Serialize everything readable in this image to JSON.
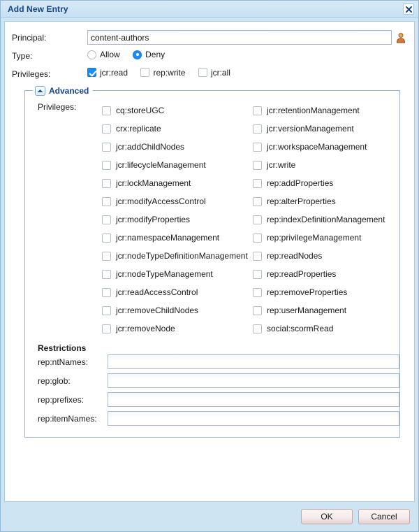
{
  "window": {
    "title": "Add New Entry",
    "close_icon": "close-icon",
    "close_label": "X"
  },
  "form": {
    "principal": {
      "label": "Principal:",
      "value": "content-authors",
      "placeholder": "",
      "picker_icon": "user-picker-icon"
    },
    "type": {
      "label": "Type:",
      "options": [
        {
          "label": "Allow",
          "checked": false
        },
        {
          "label": "Deny",
          "checked": true
        }
      ]
    },
    "privileges": {
      "label": "Privileges:",
      "options": [
        {
          "label": "jcr:read",
          "checked": true
        },
        {
          "label": "rep:write",
          "checked": false
        },
        {
          "label": "jcr:all",
          "checked": false
        }
      ]
    }
  },
  "advanced": {
    "title": "Advanced",
    "toggle_icon": "chevron-up-icon",
    "expanded": true,
    "privileges_label": "Privileges:",
    "left_column": [
      {
        "label": "cq:storeUGC",
        "checked": false
      },
      {
        "label": "crx:replicate",
        "checked": false
      },
      {
        "label": "jcr:addChildNodes",
        "checked": false
      },
      {
        "label": "jcr:lifecycleManagement",
        "checked": false
      },
      {
        "label": "jcr:lockManagement",
        "checked": false
      },
      {
        "label": "jcr:modifyAccessControl",
        "checked": false
      },
      {
        "label": "jcr:modifyProperties",
        "checked": false
      },
      {
        "label": "jcr:namespaceManagement",
        "checked": false
      },
      {
        "label": "jcr:nodeTypeDefinitionManagement",
        "checked": false
      },
      {
        "label": "jcr:nodeTypeManagement",
        "checked": false
      },
      {
        "label": "jcr:readAccessControl",
        "checked": false
      },
      {
        "label": "jcr:removeChildNodes",
        "checked": false
      },
      {
        "label": "jcr:removeNode",
        "checked": false
      }
    ],
    "right_column": [
      {
        "label": "jcr:retentionManagement",
        "checked": false
      },
      {
        "label": "jcr:versionManagement",
        "checked": false
      },
      {
        "label": "jcr:workspaceManagement",
        "checked": false
      },
      {
        "label": "jcr:write",
        "checked": false
      },
      {
        "label": "rep:addProperties",
        "checked": false
      },
      {
        "label": "rep:alterProperties",
        "checked": false
      },
      {
        "label": "rep:indexDefinitionManagement",
        "checked": false
      },
      {
        "label": "rep:privilegeManagement",
        "checked": false
      },
      {
        "label": "rep:readNodes",
        "checked": false
      },
      {
        "label": "rep:readProperties",
        "checked": false
      },
      {
        "label": "rep:removeProperties",
        "checked": false
      },
      {
        "label": "rep:userManagement",
        "checked": false
      },
      {
        "label": "social:scormRead",
        "checked": false
      }
    ],
    "restrictions": {
      "title": "Restrictions",
      "fields": [
        {
          "label": "rep:ntNames:",
          "value": "",
          "placeholder": ""
        },
        {
          "label": "rep:glob:",
          "value": "",
          "placeholder": ""
        },
        {
          "label": "rep:prefixes:",
          "value": "",
          "placeholder": ""
        },
        {
          "label": "rep:itemNames:",
          "value": "",
          "placeholder": ""
        }
      ]
    }
  },
  "footer": {
    "ok_label": "OK",
    "cancel_label": "Cancel"
  },
  "colors": {
    "chrome": "#cfe4f3",
    "title_text": "#15428b",
    "accent": "#1a8cff",
    "fieldset_border": "#9bb2cc"
  }
}
